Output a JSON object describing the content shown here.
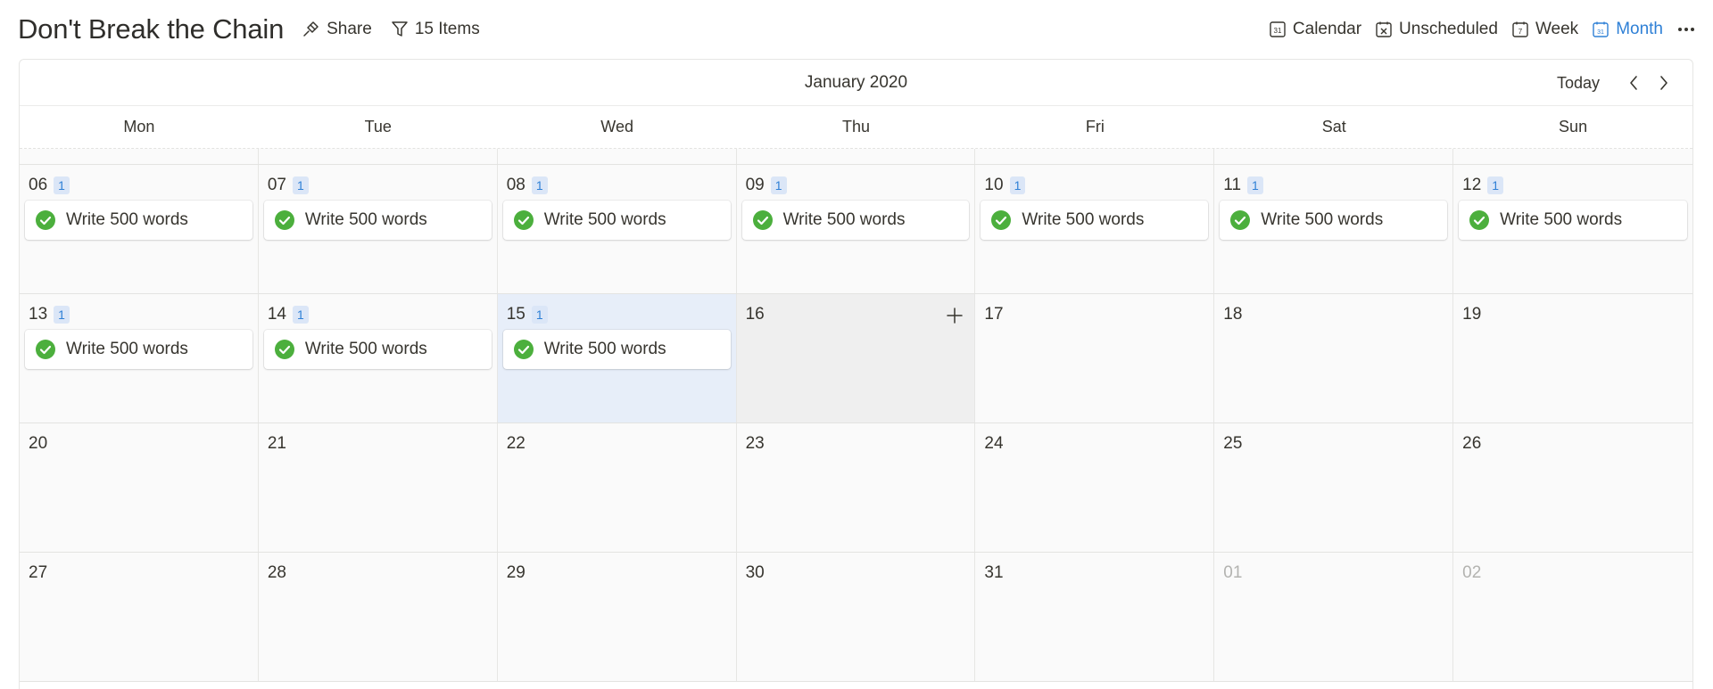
{
  "page": {
    "title": "Don't Break the Chain",
    "share_label": "Share",
    "filter_label": "15 Items"
  },
  "views": {
    "calendar_label": "Calendar",
    "unscheduled_label": "Unscheduled",
    "week_label": "Week",
    "month_label": "Month",
    "active": "Month"
  },
  "calendar": {
    "month_label": "January 2020",
    "today_label": "Today",
    "weekdays": [
      "Mon",
      "Tue",
      "Wed",
      "Thu",
      "Fri",
      "Sat",
      "Sun"
    ],
    "weeks": [
      [
        {
          "num": "06",
          "badge": "1",
          "event": "Write 500 words"
        },
        {
          "num": "07",
          "badge": "1",
          "event": "Write 500 words"
        },
        {
          "num": "08",
          "badge": "1",
          "event": "Write 500 words"
        },
        {
          "num": "09",
          "badge": "1",
          "event": "Write 500 words"
        },
        {
          "num": "10",
          "badge": "1",
          "event": "Write 500 words"
        },
        {
          "num": "11",
          "badge": "1",
          "event": "Write 500 words"
        },
        {
          "num": "12",
          "badge": "1",
          "event": "Write 500 words"
        }
      ],
      [
        {
          "num": "13",
          "badge": "1",
          "event": "Write 500 words"
        },
        {
          "num": "14",
          "badge": "1",
          "event": "Write 500 words"
        },
        {
          "num": "15",
          "badge": "1",
          "event": "Write 500 words",
          "today": true
        },
        {
          "num": "16",
          "hover": true
        },
        {
          "num": "17"
        },
        {
          "num": "18"
        },
        {
          "num": "19"
        }
      ],
      [
        {
          "num": "20"
        },
        {
          "num": "21"
        },
        {
          "num": "22"
        },
        {
          "num": "23"
        },
        {
          "num": "24"
        },
        {
          "num": "25"
        },
        {
          "num": "26"
        }
      ],
      [
        {
          "num": "27"
        },
        {
          "num": "28"
        },
        {
          "num": "29"
        },
        {
          "num": "30"
        },
        {
          "num": "31"
        },
        {
          "num": "01",
          "muted": true
        },
        {
          "num": "02",
          "muted": true
        }
      ]
    ]
  },
  "colors": {
    "accent": "#2f80d6",
    "check_green": "#4caf3d",
    "today_bg": "#e7eef9",
    "badge_bg": "#dbe6f7"
  },
  "icons": {
    "share": "share-icon",
    "filter": "filter-icon",
    "calendar": "calendar-icon",
    "unscheduled": "calendar-x-icon",
    "week": "calendar-week-icon",
    "month": "calendar-month-icon",
    "more": "more-horizontal-icon",
    "prev": "chevron-left-icon",
    "next": "chevron-right-icon",
    "add": "plus-icon",
    "check": "check-circle-icon"
  }
}
